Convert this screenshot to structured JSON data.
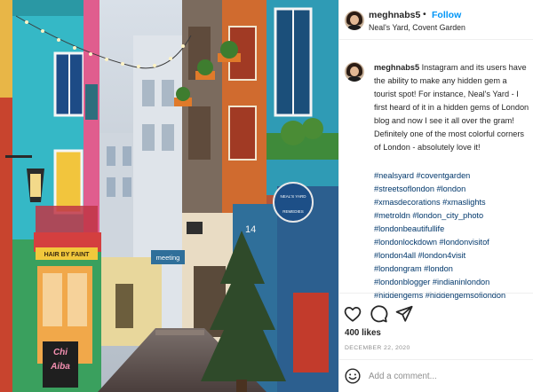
{
  "post": {
    "username": "meghnabs5",
    "follow_label": "Follow",
    "location": "Neal's Yard, Covent Garden",
    "caption_text": "Instagram and its users have the ability to make any hidden gem a tourist spot! For instance, Neal's Yard - I first heard of it in a hidden gems of London blog and now I see it all over the gram! Definitely one of the most colorful corners of London - absolutely love it!",
    "hashtag_lines": [
      "#nealsyard #coventgarden",
      "#streetsoflondon #london",
      "#xmasdecorations #xmaslights",
      "#metroldn #london_city_photo",
      "#londonbeautifullife",
      "#londonlockdown #londonvisitof",
      "#london4all #london4visit",
      "#londongram #london",
      "#londonblogger #indianinlondon",
      "#hiddengems #hiddengemsoflondon"
    ],
    "likes": "400 likes",
    "date": "December 22, 2020",
    "comment_placeholder": "Add a comment..."
  },
  "photo": {
    "signs": {
      "chi": "Chi",
      "aiba": "Aiba",
      "hair_shop": "HAIR BY FAINT",
      "meeting": "meeting",
      "neals_yard": "NEAL'S YARD",
      "remedies": "REMEDIES",
      "shop_number": "14"
    }
  },
  "icons": {
    "follow_dot": "•",
    "like": "heart-icon",
    "comment": "comment-icon",
    "share": "share-icon",
    "emoji": "smiley-icon"
  },
  "colors": {
    "accent": "#0095f6",
    "hashtag": "#00376b",
    "muted": "#8e8e8e",
    "divider": "#efefef"
  }
}
